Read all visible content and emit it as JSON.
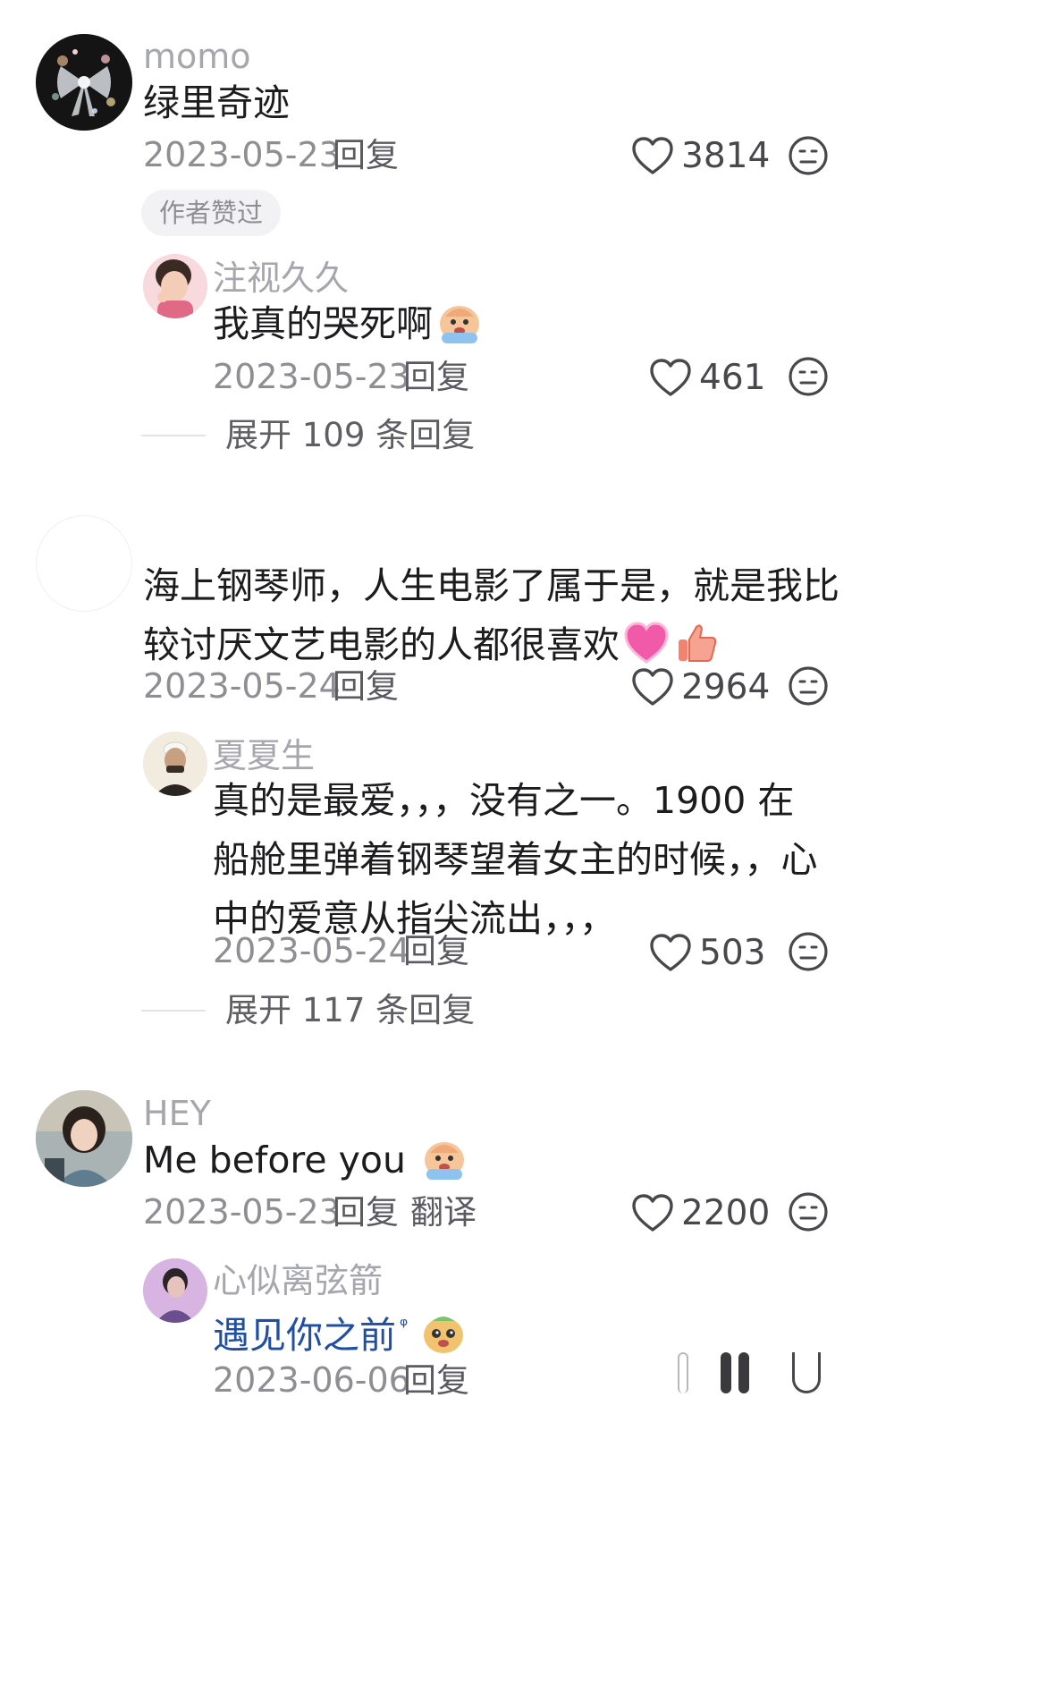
{
  "comments": [
    {
      "user": "momo",
      "text": "绿里奇迹",
      "date": "2023-05-23",
      "reply_label": "回复",
      "likes": "3814",
      "badge": "作者赞过",
      "sub_reply": {
        "user": "注视久久",
        "text": "我真的哭死啊",
        "date": "2023-05-23",
        "reply_label": "回复",
        "likes": "461"
      },
      "expand_label": "展开 109 条回复"
    },
    {
      "user": "",
      "text": "海上钢琴师，人生电影了属于是，就是我比较讨厌文艺电影的人都很喜欢",
      "date": "2023-05-24",
      "reply_label": "回复",
      "likes": "2964",
      "sub_reply": {
        "user": "夏夏生",
        "text": "真的是最爱，，，没有之一。1900 在船舱里弹着钢琴望着女主的时候，，心中的爱意从指尖流出，，，",
        "date": "2023-05-24",
        "reply_label": "回复",
        "likes": "503"
      },
      "expand_label": "展开 117 条回复"
    },
    {
      "user": "HEY",
      "text": "Me before you",
      "date": "2023-05-23",
      "reply_label": "回复",
      "translate_label": "翻译",
      "likes": "2200",
      "sub_reply": {
        "user": "心似离弦箭",
        "text": "遇见你之前",
        "date": "2023-06-06",
        "reply_label": "回复"
      }
    }
  ],
  "colors": {
    "username": "#a6a6ad",
    "meta": "#8e8e93",
    "text": "#1c1c1e"
  }
}
